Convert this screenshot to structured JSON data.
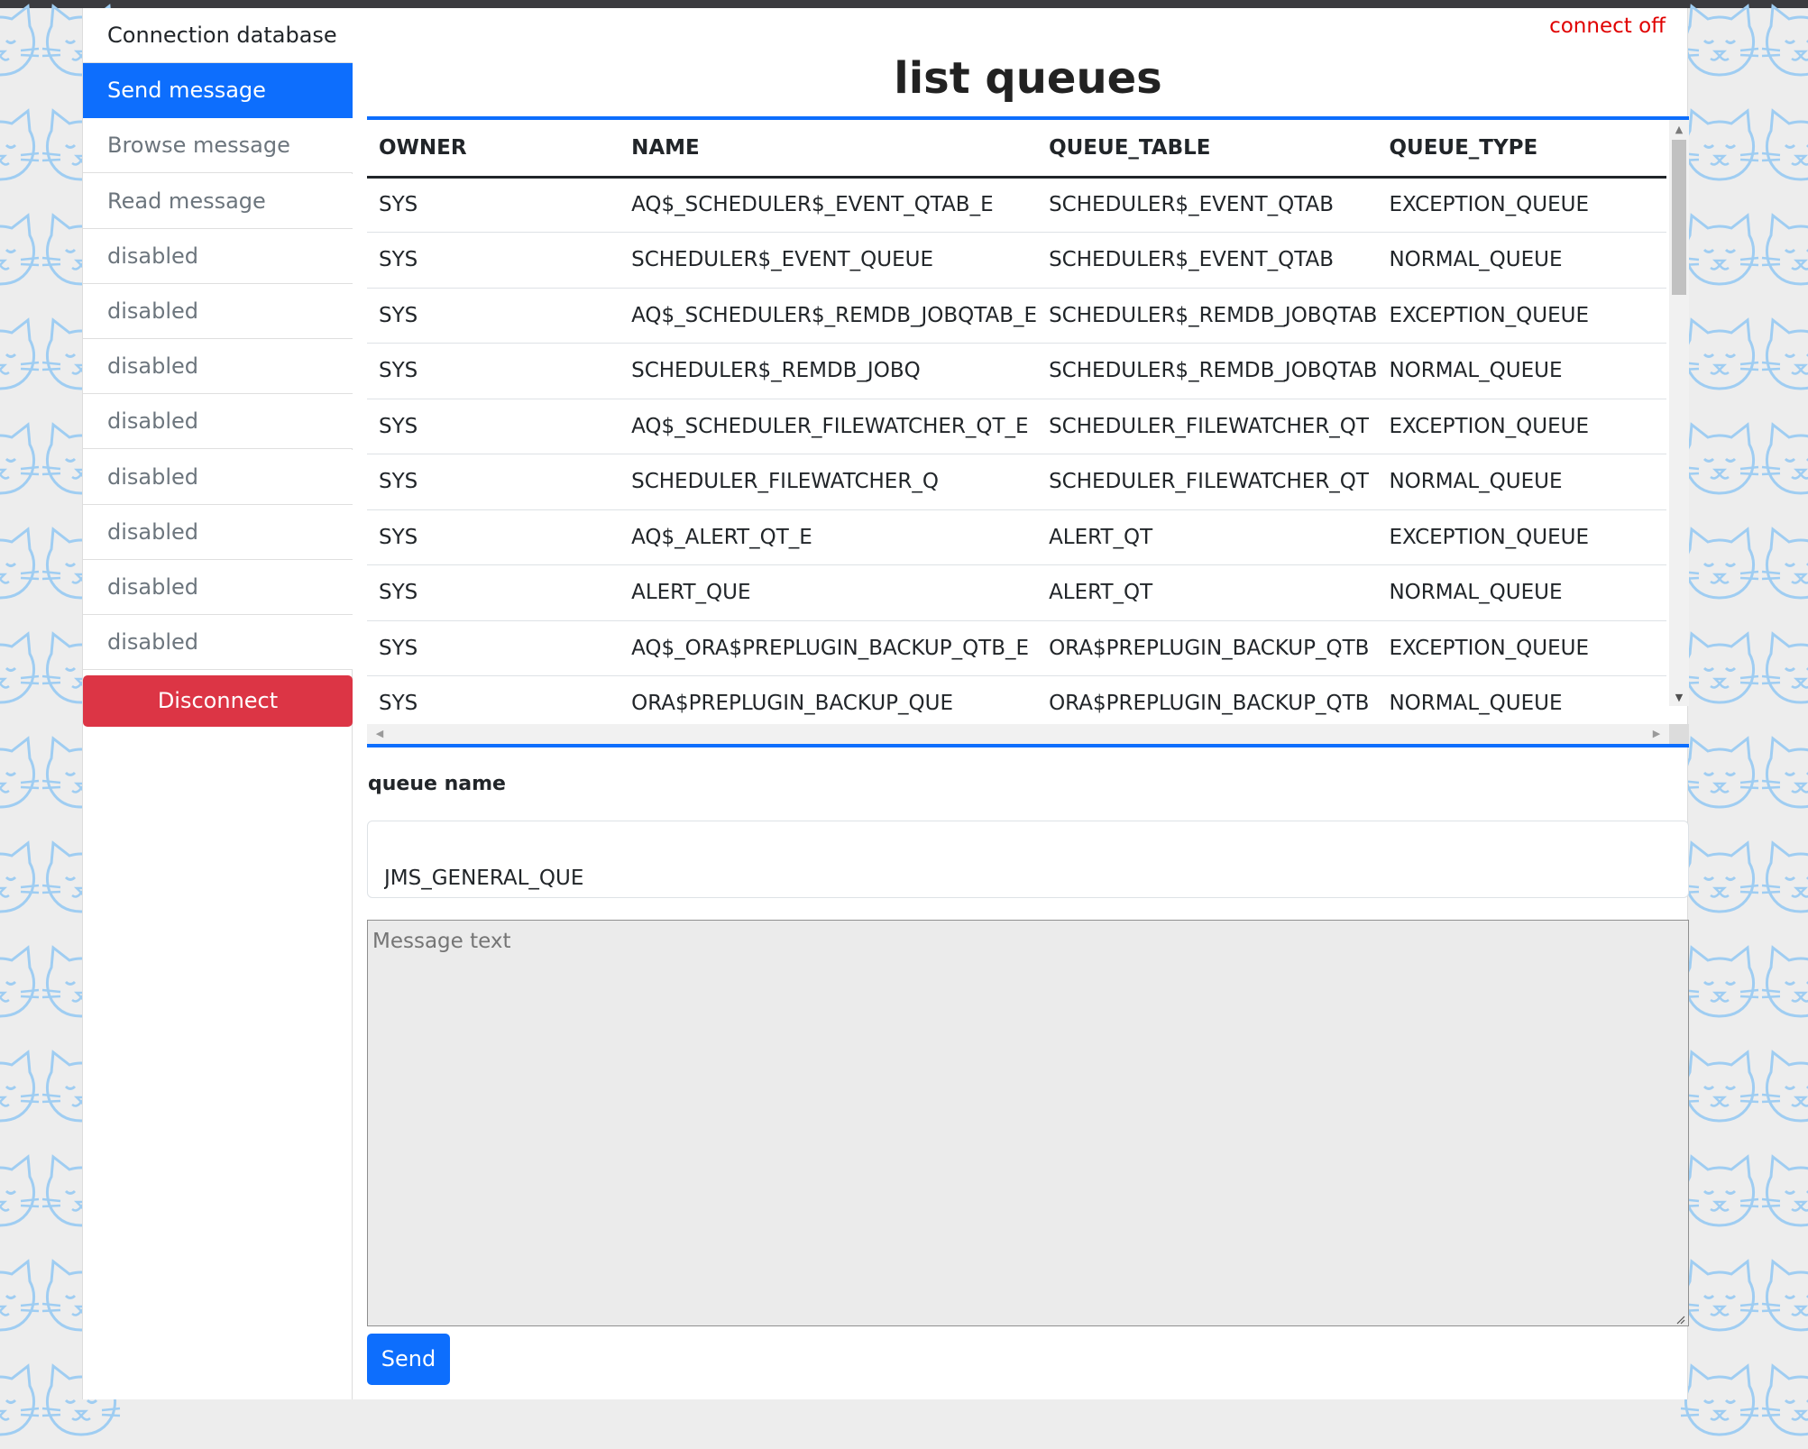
{
  "sidebar": {
    "items": [
      {
        "label": "Connection database",
        "state": "normal"
      },
      {
        "label": "Send message",
        "state": "active"
      },
      {
        "label": "Browse message",
        "state": "muted"
      },
      {
        "label": "Read message",
        "state": "muted"
      },
      {
        "label": "disabled",
        "state": "muted"
      },
      {
        "label": "disabled",
        "state": "muted"
      },
      {
        "label": "disabled",
        "state": "muted"
      },
      {
        "label": "disabled",
        "state": "muted"
      },
      {
        "label": "disabled",
        "state": "muted"
      },
      {
        "label": "disabled",
        "state": "muted"
      },
      {
        "label": "disabled",
        "state": "muted"
      },
      {
        "label": "disabled",
        "state": "muted"
      }
    ],
    "disconnect_label": "Disconnect"
  },
  "header": {
    "status": "connect off",
    "title": "list queues"
  },
  "queues_table": {
    "columns": [
      "OWNER",
      "NAME",
      "QUEUE_TABLE",
      "QUEUE_TYPE"
    ],
    "rows": [
      [
        "SYS",
        "AQ$_SCHEDULER$_EVENT_QTAB_E",
        "SCHEDULER$_EVENT_QTAB",
        "EXCEPTION_QUEUE"
      ],
      [
        "SYS",
        "SCHEDULER$_EVENT_QUEUE",
        "SCHEDULER$_EVENT_QTAB",
        "NORMAL_QUEUE"
      ],
      [
        "SYS",
        "AQ$_SCHEDULER$_REMDB_JOBQTAB_E",
        "SCHEDULER$_REMDB_JOBQTAB",
        "EXCEPTION_QUEUE"
      ],
      [
        "SYS",
        "SCHEDULER$_REMDB_JOBQ",
        "SCHEDULER$_REMDB_JOBQTAB",
        "NORMAL_QUEUE"
      ],
      [
        "SYS",
        "AQ$_SCHEDULER_FILEWATCHER_QT_E",
        "SCHEDULER_FILEWATCHER_QT",
        "EXCEPTION_QUEUE"
      ],
      [
        "SYS",
        "SCHEDULER_FILEWATCHER_Q",
        "SCHEDULER_FILEWATCHER_QT",
        "NORMAL_QUEUE"
      ],
      [
        "SYS",
        "AQ$_ALERT_QT_E",
        "ALERT_QT",
        "EXCEPTION_QUEUE"
      ],
      [
        "SYS",
        "ALERT_QUE",
        "ALERT_QT",
        "NORMAL_QUEUE"
      ],
      [
        "SYS",
        "AQ$_ORA$PREPLUGIN_BACKUP_QTB_E",
        "ORA$PREPLUGIN_BACKUP_QTB",
        "EXCEPTION_QUEUE"
      ],
      [
        "SYS",
        "ORA$PREPLUGIN_BACKUP_QUE",
        "ORA$PREPLUGIN_BACKUP_QTB",
        "NORMAL_QUEUE"
      ]
    ]
  },
  "form": {
    "queue_label": "queue name",
    "queue_value": "JMS_GENERAL_QUE",
    "message_placeholder": "Message text",
    "send_label": "Send"
  },
  "colors": {
    "accent": "#0d6efd",
    "danger": "#dc3545",
    "status_red": "#e00000",
    "pattern_cat": "#9fcdf2"
  },
  "icons": {
    "background_pattern": "cat-face-icon"
  }
}
